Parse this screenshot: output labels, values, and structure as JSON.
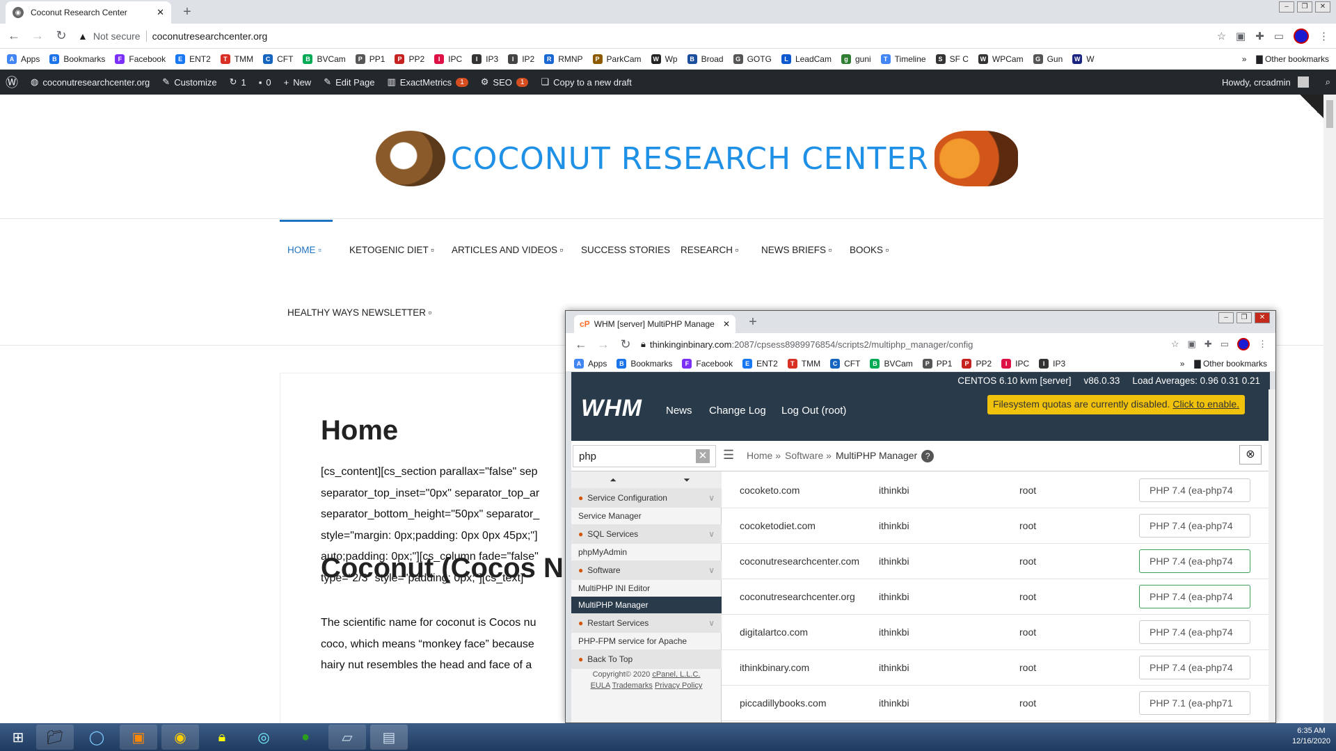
{
  "browser": {
    "tab_title": "Coconut Research Center",
    "url": "coconutresearchcenter.org",
    "not_secure": "Not secure"
  },
  "bookmarks": [
    "Apps",
    "Bookmarks",
    "Facebook",
    "ENT2",
    "TMM",
    "CFT",
    "BVCam",
    "PP1",
    "PP2",
    "IPC",
    "IP3",
    "IP2",
    "RMNP",
    "ParkCam",
    "Wp",
    "Broad",
    "GOTG",
    "LeadCam",
    "guni",
    "Timeline",
    "SF C",
    "WPCam",
    "Gun",
    "W"
  ],
  "bookmarks_more": "»",
  "other_bookmarks": "Other bookmarks",
  "wpbar": {
    "site": "coconutresearchcenter.org",
    "customize": "Customize",
    "updates": "1",
    "comments": "0",
    "new": "New",
    "edit": "Edit Page",
    "exact": "ExactMetrics",
    "exact_badge": "1",
    "seo": "SEO",
    "seo_badge": "1",
    "copy": "Copy to a new draft",
    "howdy": "Howdy, crcadmin"
  },
  "site": {
    "logo": "COCONUT RESEARCH CENTER",
    "menu": [
      "HOME ▫",
      "KETOGENIC DIET ▫",
      "ARTICLES AND VIDEOS ▫",
      "SUCCESS STORIES",
      "RESEARCH ▫",
      "NEWS BRIEFS ▫",
      "BOOKS ▫"
    ],
    "menu2": "HEALTHY WAYS NEWSLETTER ▫",
    "h1": "Home",
    "p1": [
      "[cs_content][cs_section parallax=\"false\" sep",
      "separator_top_inset=\"0px\" separator_top_ar",
      "separator_bottom_height=\"50px\" separator_",
      "style=\"margin: 0px;padding: 0px 0px 45px;\"]",
      "auto;padding: 0px;\"][cs_column fade=\"false\"",
      "type=\"2/3\" style=\"padding: 0px;\"][cs_text]"
    ],
    "h2": "Coconut (Cocos Nu",
    "p2": [
      "The scientific name for coconut is Cocos nu",
      "coco, which means “monkey face” because",
      "hairy nut resembles the head and face of a"
    ]
  },
  "whm": {
    "tab_title": "WHM [server] MultiPHP Manage",
    "url_host": "thinkinginbinary.com",
    "url_rest": ":2087/cpsess8989976854/scripts2/multiphp_manager/config",
    "bookmarks": [
      "Apps",
      "Bookmarks",
      "Facebook",
      "ENT2",
      "TMM",
      "CFT",
      "BVCam",
      "PP1",
      "PP2",
      "IPC",
      "IP3"
    ],
    "server": "CENTOS 6.10 kvm [server]",
    "version": "v86.0.33",
    "loads": "Load Averages: 0.96 0.31 0.21",
    "logo": "WHM",
    "nav": [
      "News",
      "Change Log",
      "Log Out (root)"
    ],
    "quota": "Filesystem quotas are currently disabled.",
    "quota_link": "Click to enable.",
    "search": "php",
    "crumbs": [
      "Home »",
      "Software »",
      "MultiPHP Manager"
    ],
    "side": [
      {
        "t": "Service Configuration",
        "s": "sec"
      },
      {
        "t": "Service Manager",
        "s": ""
      },
      {
        "t": "SQL Services",
        "s": "sec"
      },
      {
        "t": "phpMyAdmin",
        "s": ""
      },
      {
        "t": "Software",
        "s": "sec"
      },
      {
        "t": "MultiPHP INI Editor",
        "s": ""
      },
      {
        "t": "MultiPHP Manager",
        "s": "sel"
      },
      {
        "t": "Restart Services",
        "s": "sec"
      },
      {
        "t": "PHP-FPM service for Apache",
        "s": ""
      },
      {
        "t": "Back To Top",
        "s": "sec"
      }
    ],
    "copyright": "Copyright© 2020",
    "cpanel": "cPanel, L.L.C.",
    "eula": "EULA",
    "trademarks": "Trademarks",
    "privacy": "Privacy Policy",
    "rows": [
      [
        "cocoketo.com",
        "ithinkbi",
        "root",
        "PHP 7.4 (ea-php74"
      ],
      [
        "cocoketodiet.com",
        "ithinkbi",
        "root",
        "PHP 7.4 (ea-php74"
      ],
      [
        "coconutresearchcenter.com",
        "ithinkbi",
        "root",
        "PHP 7.4 (ea-php74"
      ],
      [
        "coconutresearchcenter.org",
        "ithinkbi",
        "root",
        "PHP 7.4 (ea-php74"
      ],
      [
        "digitalartco.com",
        "ithinkbi",
        "root",
        "PHP 7.4 (ea-php74"
      ],
      [
        "ithinkbinary.com",
        "ithinkbi",
        "root",
        "PHP 7.4 (ea-php74"
      ],
      [
        "piccadillybooks.com",
        "ithinkbi",
        "root",
        "PHP 7.1 (ea-php71"
      ]
    ]
  },
  "tray": {
    "time": "6:35 AM",
    "date": "12/16/2020"
  }
}
